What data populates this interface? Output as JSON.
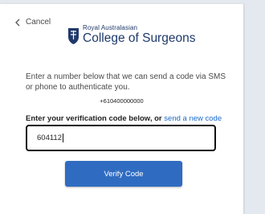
{
  "header": {
    "cancel_label": "Cancel",
    "logo_subtitle": "Royal Australasian",
    "logo_title": "College of Surgeons"
  },
  "main": {
    "intro_text": "Enter a number below that we can send a code via SMS or phone to authenticate you.",
    "phone_number": "+610400000000",
    "prompt_text": "Enter your verification code below, or",
    "resend_link": "send a new code",
    "code_value": "604112",
    "verify_label": "Verify Code"
  },
  "colors": {
    "brand_navy": "#1f3a6b",
    "button_blue": "#2f6cc1",
    "link_blue": "#1b6ac9"
  },
  "icons": {
    "back": "chevron-left-icon",
    "logo": "crest-icon"
  }
}
